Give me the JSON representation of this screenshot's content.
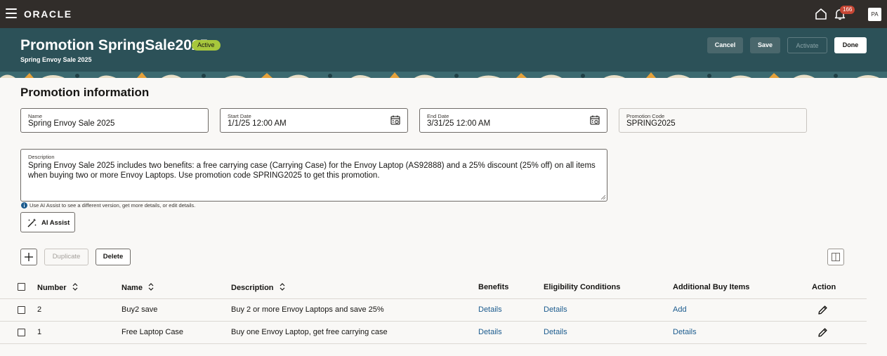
{
  "topbar": {
    "logo": "ORACLE",
    "notification_count": "166",
    "avatar_initials": "PA",
    "icons": [
      "hamburger-menu-icon",
      "home-icon",
      "bell-icon"
    ]
  },
  "header": {
    "title": "Promotion SpringSale2025",
    "status": "Active",
    "subtitle": "Spring Envoy Sale 2025",
    "buttons": {
      "cancel": "Cancel",
      "save": "Save",
      "activate": "Activate",
      "done": "Done"
    }
  },
  "section": {
    "title": "Promotion information"
  },
  "fields": {
    "name": {
      "label": "Name",
      "value": "Spring Envoy Sale 2025"
    },
    "start_date": {
      "label": "Start Date",
      "value": "1/1/25 12:00 AM"
    },
    "end_date": {
      "label": "End Date",
      "value": "3/31/25 12:00 AM"
    },
    "promotion_code": {
      "label": "Promotion Code",
      "value": "SPRING2025"
    },
    "description": {
      "label": "Description",
      "value": "Spring Envoy Sale 2025 includes two benefits: a free carrying case (Carrying Case) for the Envoy Laptop (AS92888) and a 25% discount (25% off) on all items when buying two or more Envoy Laptops. Use promotion code SPRING2025 to get this promotion."
    }
  },
  "ai": {
    "hint": "Use AI Assist to see a different version, get more details, or edit details.",
    "button": "AI Assist"
  },
  "toolbar": {
    "duplicate": "Duplicate",
    "delete": "Delete"
  },
  "table": {
    "columns": [
      "Number",
      "Name",
      "Description",
      "Benefits",
      "Eligibility Conditions",
      "Additional Buy Items",
      "Action"
    ],
    "rows": [
      {
        "number": "2",
        "name": "Buy2 save",
        "description": "Buy 2 or more Envoy Laptops and save 25%",
        "benefits": "Details",
        "eligibility": "Details",
        "additional": "Add"
      },
      {
        "number": "1",
        "name": "Free Laptop Case",
        "description": "Buy one Envoy Laptop, get free carrying case",
        "benefits": "Details",
        "eligibility": "Details",
        "additional": "Details"
      }
    ]
  },
  "colors": {
    "topbar": "#312d2a",
    "header_band": "#2c5158",
    "status_badge": "#a7c73c",
    "link": "#1b5b8e",
    "notification": "#c74634"
  }
}
